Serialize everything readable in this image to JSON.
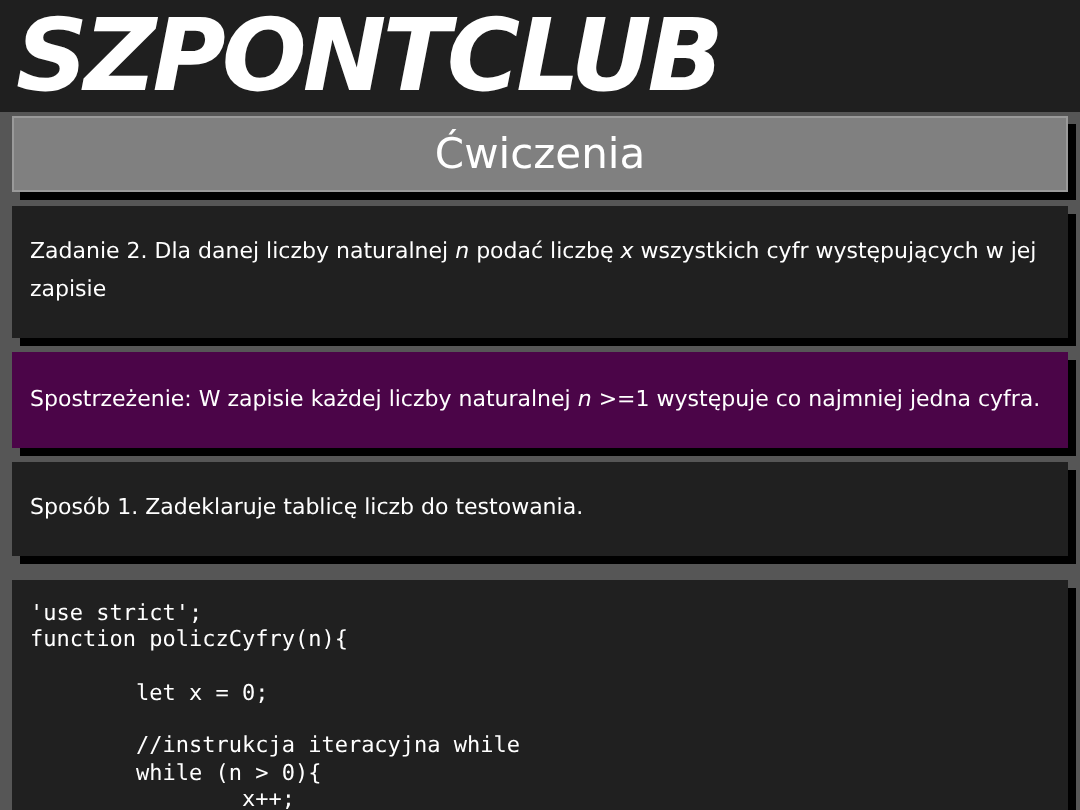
{
  "logo": "SZPONTCLUB",
  "heading": "Ćwiczenia",
  "cards": [
    {
      "kind": "task",
      "text": "Zadanie 2. Dla danej liczby naturalnej *n* podać liczbę *x* wszystkich cyfr występujących w jej zapisie"
    },
    {
      "kind": "note",
      "text": "Spostrzeżenie: W zapisie każdej liczby naturalnej *n* >=1 występuje co najmniej jedna cyfra."
    },
    {
      "kind": "text",
      "text": "Sposób 1. Zadeklaruje tablicę liczb do testowania."
    },
    {
      "kind": "code",
      "lines": [
        {
          "text": "'use strict';",
          "gap_before": false
        },
        {
          "text": "function policzCyfry(n){",
          "gap_before": false
        },
        {
          "text": "        let x = 0;",
          "gap_before": true
        },
        {
          "text": "        //instrukcja iteracyjna while",
          "gap_before": true
        },
        {
          "text": "        while (n > 0){",
          "gap_before": false
        },
        {
          "text": "                x++;",
          "gap_before": false
        }
      ]
    }
  ]
}
